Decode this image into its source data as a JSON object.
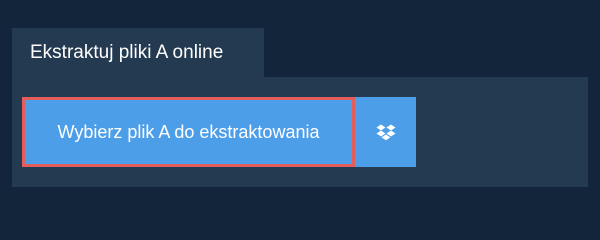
{
  "tab": {
    "label": "Ekstraktuj pliki A online"
  },
  "upload": {
    "button_label": "Wybierz plik A do ekstraktowania",
    "dropbox_icon": "dropbox-icon"
  },
  "colors": {
    "page_background": "#13253a",
    "panel_background": "#233a51",
    "button_background": "#4d9ee9",
    "button_outline": "#e35d5d",
    "text": "#ffffff"
  }
}
